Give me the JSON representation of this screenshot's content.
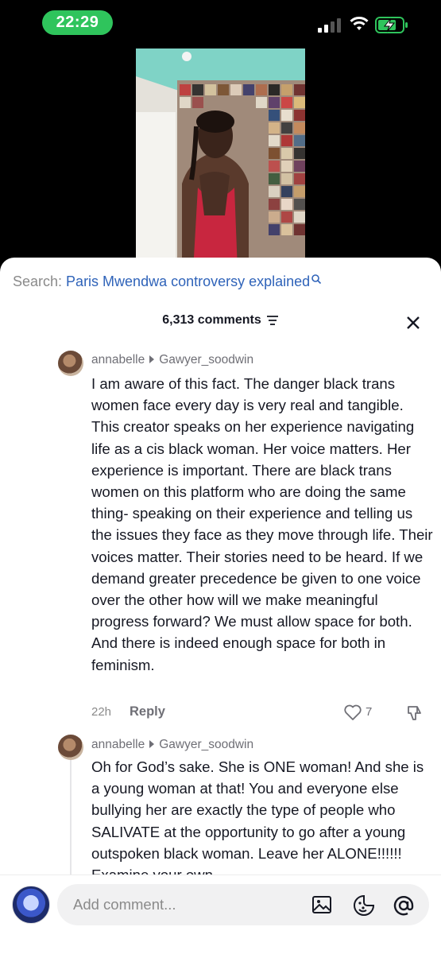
{
  "status_bar": {
    "time": "22:29",
    "accent": "#2fc45c"
  },
  "search": {
    "prefix": "Search: ",
    "query": "Paris Mwendwa controversy explained",
    "icon": "search-icon"
  },
  "comments_header": {
    "count_label": "6,313 comments",
    "filter_icon": "filter-icon",
    "close_icon": "close-icon"
  },
  "comments": [
    {
      "author": "annabelle",
      "reply_to": "Gawyer_soodwin",
      "text": "I am aware of this fact. The danger black trans women face every day is very real and tangible. This creator speaks on her experience navigating life as a cis black woman. Her voice matters. Her experience is important. There are black trans women on this platform who are doing the same thing- speaking on their experience and telling us the issues they face as they move through life. Their voices matter. Their stories need to be heard. If we demand greater precedence be given to one voice over the other how will we make meaningful progress forward? We must allow space for both. And there is indeed enough space for both in feminism.",
      "time": "22h",
      "reply_label": "Reply",
      "likes": "7"
    },
    {
      "author": "annabelle",
      "reply_to": "Gawyer_soodwin",
      "text": "Oh for God’s sake. She is ONE woman! And she is a young woman at that! You and everyone else bullying her are exactly the type of people who SALIVATE at the opportunity to go after a young outspoken black woman. Leave her ALONE!!!!!! Examine your own"
    }
  ],
  "input": {
    "placeholder": "Add comment...",
    "icons": [
      "image-icon",
      "emoji-icon",
      "mention-icon"
    ]
  },
  "colors": {
    "link": "#2f63b9",
    "text": "#161823",
    "muted": "#8a8a8a"
  }
}
